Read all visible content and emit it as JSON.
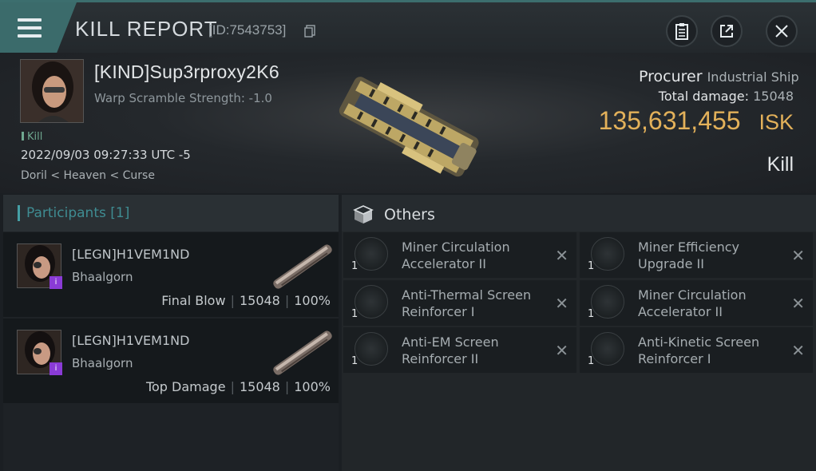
{
  "header": {
    "title": "KILL REPORT",
    "id": "[ID:7543753]"
  },
  "victim": {
    "name": "[KIND]Sup3rproxy2K6",
    "warp_scramble": "Warp Scramble Strength: -1.0",
    "kill_tag": "Kill",
    "date": "2022/09/03 09:27:33 UTC -5",
    "location": "Doril < Heaven < Curse",
    "ship_name": "Procurer",
    "ship_class": "Industrial Ship",
    "total_damage_label": "Total damage:",
    "total_damage": "15048",
    "isk_value": "135,631,455",
    "isk_unit": "ISK",
    "kill_type": "Kill"
  },
  "participants": {
    "title": "Participants",
    "count": "[1]",
    "rows": [
      {
        "name": "[LEGN]H1VEM1ND",
        "corp": "Bhaalgorn",
        "role": "Final Blow",
        "damage": "15048",
        "percent": "100%"
      },
      {
        "name": "[LEGN]H1VEM1ND",
        "corp": "Bhaalgorn",
        "role": "Top Damage",
        "damage": "15048",
        "percent": "100%"
      }
    ]
  },
  "others": {
    "title": "Others",
    "items": [
      {
        "qty": "1",
        "name": "Miner Circulation Accelerator II",
        "icon": "mining-upgrade-icon"
      },
      {
        "qty": "1",
        "name": "Miner Efficiency Upgrade II",
        "icon": "mining-upgrade-icon"
      },
      {
        "qty": "1",
        "name": "Anti-Thermal Screen Reinforcer I",
        "icon": "shield-rig-icon"
      },
      {
        "qty": "1",
        "name": "Miner Circulation Accelerator II",
        "icon": "mining-upgrade-icon"
      },
      {
        "qty": "1",
        "name": "Anti-EM Screen Reinforcer II",
        "icon": "shield-rig-icon"
      },
      {
        "qty": "1",
        "name": "Anti-Kinetic Screen Reinforcer I",
        "icon": "shield-rig-icon"
      }
    ]
  }
}
